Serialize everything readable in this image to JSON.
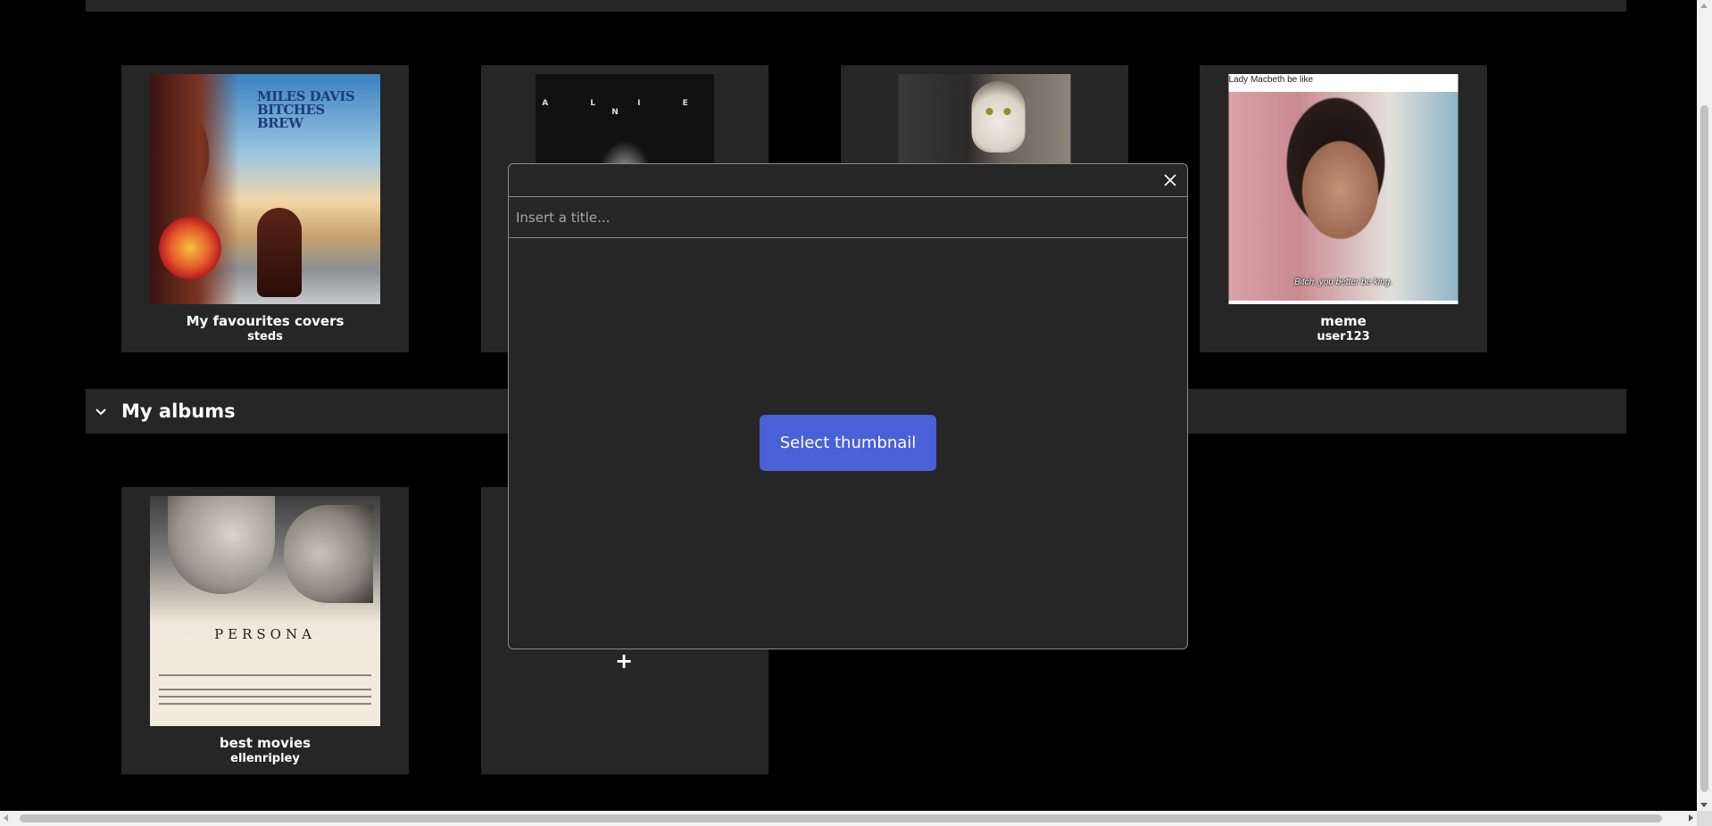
{
  "shared_albums": [
    {
      "title": "My favourites covers",
      "author": "steds",
      "cover": {
        "text": "MILES DAVIS BITCHES BREW"
      }
    },
    {
      "title": "",
      "author": "",
      "cover": {
        "text": "A L I E N"
      }
    },
    {
      "title": "",
      "author": "",
      "cover": {
        "text": ""
      }
    },
    {
      "title": "meme",
      "author": "user123",
      "cover": {
        "caption_top": "Lady Macbeth be like",
        "subtitle": "Bitch, you better be king."
      }
    }
  ],
  "my_albums_section": {
    "title": "My albums",
    "icon": "chevron-down-icon"
  },
  "my_albums": [
    {
      "title": "best movies",
      "author": "ellenripley",
      "cover": {
        "text": "PERSONA"
      }
    }
  ],
  "add_album": {
    "icon": "plus-icon",
    "symbol": "+"
  },
  "modal": {
    "title_placeholder": "Insert a title...",
    "select_thumbnail_label": "Select thumbnail",
    "close_icon": "close-icon"
  },
  "colors": {
    "background": "#000000",
    "panel": "#262626",
    "accent": "#4a60d6",
    "border": "#8a8a8a"
  }
}
